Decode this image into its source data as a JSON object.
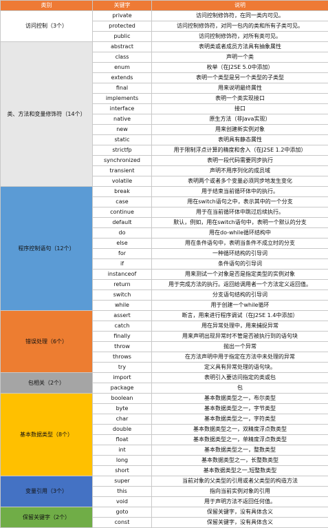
{
  "headers": [
    "类别",
    "关键字",
    "说明"
  ],
  "groups": [
    {
      "name": "访问控制（3个）",
      "color": "#ffffff",
      "dark": false,
      "rows": [
        [
          "private",
          "访问控制修饰符，在同一类内可见。"
        ],
        [
          "protected",
          "访问控制修饰符，对同一包内的类和所有子类可见。"
        ],
        [
          "public",
          "访问控制修饰符，对所有类可见。"
        ]
      ]
    },
    {
      "name": "类、方法和变量修饰符（14个）",
      "color": "#e7e7e7",
      "dark": false,
      "rows": [
        [
          "abstract",
          "表明类或者成员方法具有抽象属性"
        ],
        [
          "class",
          "声明一个类"
        ],
        [
          "enum",
          "枚举（在J2SE 5.0中添加）"
        ],
        [
          "extends",
          "表明一个类型是另一个类型的子类型"
        ],
        [
          "final",
          "用来说明最终属性"
        ],
        [
          "implements",
          "表明一个类实现接口"
        ],
        [
          "interface",
          "接口"
        ],
        [
          "native",
          "原生方法（非Java实现）"
        ],
        [
          "new",
          "用来创建新实例对象"
        ],
        [
          "static",
          "表明具有静态属性"
        ],
        [
          "strictfp",
          "用于限制浮点计算的精度和舍入（在J2SE 1.2中添加）"
        ],
        [
          "synchronized",
          "表明一段代码需要同步执行"
        ],
        [
          "transient",
          "声明不用序列化的成员域"
        ],
        [
          "volatile",
          "表明两个或者多个变量必须同步地发生变化"
        ]
      ]
    },
    {
      "name": "程序控制语句（12个）",
      "color": "#5b9bd5",
      "dark": false,
      "rows": [
        [
          "break",
          "用于结束当前循环体中的执行。"
        ],
        [
          "case",
          "用在switch语句之中，表示其中的一个分支"
        ],
        [
          "continue",
          "用于在当前循环体中跳过后续执行。"
        ],
        [
          "default",
          "默认，例如，用在switch语句中，表明一个默认的分支"
        ],
        [
          "do",
          "用在do-while循环结构中"
        ],
        [
          "else",
          "用在条件语句中，表明当条件不成立时的分支"
        ],
        [
          "for",
          "一种循环结构的引导词"
        ],
        [
          "if",
          "条件语句的引导词"
        ],
        [
          "instanceof",
          "用来测试一个对象是否是指定类型的实例对象"
        ],
        [
          "return",
          "用于完成方法的执行。返回给调用者一个方法定义返回值。"
        ],
        [
          "switch",
          "分支语句结构的引导词"
        ],
        [
          "while",
          "用于创建一个while循环"
        ]
      ]
    },
    {
      "name": "错误处理（6个）",
      "color": "#ed7d31",
      "dark": false,
      "rows": [
        [
          "assert",
          "断言，用来进行程序调试（在J2SE 1.4中添加）"
        ],
        [
          "catch",
          "用在异常处理中，用来捕捉异常"
        ],
        [
          "finally",
          "用来声明出现异常时不管是否被执行到的语句块"
        ],
        [
          "throw",
          "抛出一个异常"
        ],
        [
          "throws",
          "在方法声明中用于指定在方法中未处理的异常"
        ],
        [
          "try",
          "定义具有异常处理的语句块。"
        ]
      ]
    },
    {
      "name": "包相关（2个）",
      "color": "#a5a5a5",
      "dark": false,
      "rows": [
        [
          "import",
          "表明引入要访问指定的类或包"
        ],
        [
          "package",
          "包"
        ]
      ]
    },
    {
      "name": "基本数据类型（8个）",
      "color": "#ffc000",
      "dark": false,
      "rows": [
        [
          "boolean",
          "基本数据类型之一，布尔类型"
        ],
        [
          "byte",
          "基本数据类型之一，字节类型"
        ],
        [
          "char",
          "基本数据类型之一，字符类型"
        ],
        [
          "double",
          "基本数据类型之一，双精度浮点数类型"
        ],
        [
          "float",
          "基本数据类型之一，单精度浮点数类型"
        ],
        [
          "int",
          "基本数据类型之一，整数类型"
        ],
        [
          "long",
          "基本数据类型之一，长整数类型"
        ],
        [
          "short",
          "基本数据类型之一,短整数类型"
        ]
      ]
    },
    {
      "name": "变量引用（3个）",
      "color": "#4472c4",
      "dark": false,
      "rows": [
        [
          "super",
          "当前对象的父类型的引用或者父类型的构造方法"
        ],
        [
          "this",
          "指向当前实例对象的引用"
        ],
        [
          "void",
          "用于声明方法不返回任何值。"
        ]
      ]
    },
    {
      "name": "保留关键字（2个）",
      "color": "#70ad47",
      "dark": false,
      "rows": [
        [
          "goto",
          "保留关键字，没有具体含义"
        ],
        [
          "const",
          "保留关键字，没有具体含义"
        ]
      ]
    }
  ]
}
